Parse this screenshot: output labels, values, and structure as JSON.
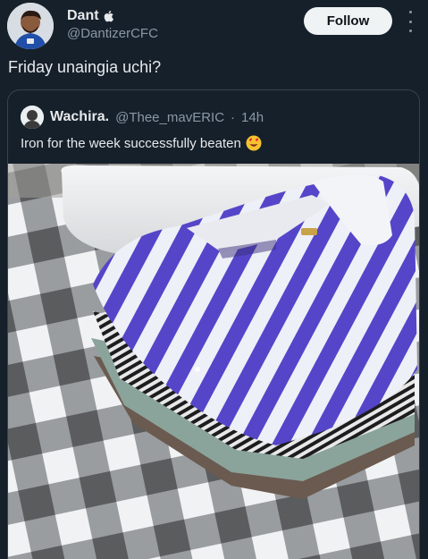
{
  "author": {
    "display_name": "Dant",
    "badge_icon": "apple-icon",
    "handle": "@DantizerCFC",
    "avatar_icon": "avatar-illustration"
  },
  "follow_label": "Follow",
  "more_icon": "more-vertical-icon",
  "tweet_text": "Friday unaingia uchi?",
  "quoted": {
    "display_name": "Wachira.",
    "handle": "@Thee_mavERIC",
    "separator": "·",
    "time": "14h",
    "text": "Iron for the week successfully beaten",
    "emoji_icon": "heart-eyes-emoji-icon"
  },
  "colors": {
    "background": "#15202b",
    "text": "#e7e9ea",
    "secondary_text": "#8b98a5",
    "border": "#38444d",
    "follow_bg": "#eff3f4"
  }
}
